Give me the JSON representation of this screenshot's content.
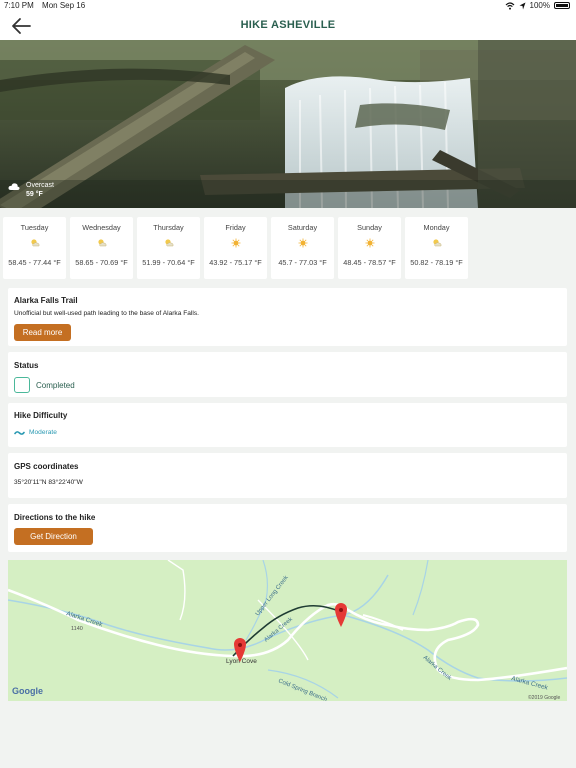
{
  "status_bar": {
    "time": "7:10 PM",
    "date": "Mon Sep 16",
    "battery": "100%"
  },
  "header": {
    "title": "HIKE ASHEVILLE"
  },
  "current_weather": {
    "condition": "Overcast",
    "temperature": "59 °F"
  },
  "forecast": [
    {
      "day": "Tuesday",
      "icon": "partly-sunny-icon",
      "range": "58.45 - 77.44 °F"
    },
    {
      "day": "Wednesday",
      "icon": "partly-sunny-icon",
      "range": "58.65 - 70.69 °F"
    },
    {
      "day": "Thursday",
      "icon": "partly-sunny-icon",
      "range": "51.99 - 70.64 °F"
    },
    {
      "day": "Friday",
      "icon": "sunny-icon",
      "range": "43.92 - 75.17 °F"
    },
    {
      "day": "Saturday",
      "icon": "sunny-icon",
      "range": "45.7 - 77.03 °F"
    },
    {
      "day": "Sunday",
      "icon": "sunny-icon",
      "range": "48.45 - 78.57 °F"
    },
    {
      "day": "Monday",
      "icon": "partly-sunny-icon",
      "range": "50.82 - 78.19 °F"
    }
  ],
  "trail": {
    "name": "Alarka Falls Trail",
    "description": "Unofficial but well-used path leading to the base of Alarka Falls.",
    "read_more": "Read more"
  },
  "status": {
    "title": "Status",
    "value": "Completed"
  },
  "difficulty": {
    "title": "Hike Difficulty",
    "value": "Moderate"
  },
  "gps": {
    "title": "GPS coordinates",
    "value": "35°20'11\"N 83°22'40\"W"
  },
  "directions": {
    "title": "Directions to the hike",
    "button": "Get Direction"
  },
  "map": {
    "labels": {
      "alarka_creek_1": "Alarka Creek",
      "alarka_creek_2": "Alarka Creek",
      "alarka_creek_3": "Alarka Creek",
      "alarka_creek_4": "Alarka Creek",
      "upper_long_creek": "Upper Long Creek",
      "cold_spring_branch": "Cold Spring Branch",
      "lyon_cove": "Lyon Cove",
      "route_1140": "1140",
      "google_logo": "Google",
      "copyright": "©2019 Google"
    }
  },
  "colors": {
    "accent": "#2a5f4f",
    "button": "#c46f22",
    "checkbox": "#4bb89a",
    "difficulty": "#2a99b2",
    "map_green": "#d5efc3"
  }
}
